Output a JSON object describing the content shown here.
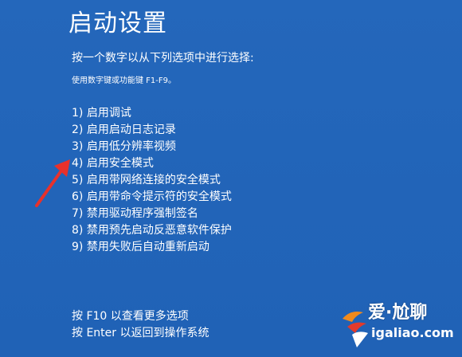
{
  "screen": {
    "title": "启动设置",
    "subtitle": "按一个数字以从下列选项中进行选择:",
    "hint": "使用数字键或功能键 F1-F9。",
    "options": [
      "1) 启用调试",
      "2) 启用启动日志记录",
      "3) 启用低分辨率视频",
      "4) 启用安全模式",
      "5) 启用带网络连接的安全模式",
      "6) 启用带命令提示符的安全模式",
      "7) 禁用驱动程序强制签名",
      "8) 禁用预先启动反恶意软件保护",
      "9) 禁用失败后自动重新启动"
    ],
    "footer": [
      "按 F10 以查看更多选项",
      "按 Enter 以返回到操作系统"
    ]
  },
  "annotation": {
    "icon": "red-arrow-icon",
    "color": "#e8312b"
  },
  "watermark": {
    "icon": "watermark-logo-icon",
    "text": "爱·尬聊",
    "url": "igaliao.com"
  },
  "colors": {
    "background": "#2265b9",
    "text": "#ffffff",
    "arrow": "#e8312b",
    "logo_orange": "#f08a1c",
    "logo_red": "#e23a2b"
  }
}
